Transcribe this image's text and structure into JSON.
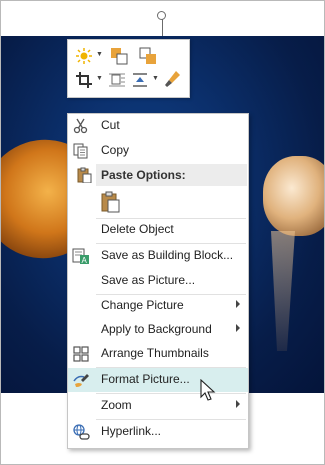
{
  "menu": {
    "cut": "Cut",
    "copy": "Copy",
    "paste_options": "Paste Options:",
    "delete_object": "Delete Object",
    "save_building_block": "Save as Building Block...",
    "save_picture": "Save as Picture...",
    "change_picture": "Change Picture",
    "apply_background": "Apply to Background",
    "arrange_thumbnails": "Arrange Thumbnails",
    "format_picture": "Format Picture...",
    "zoom": "Zoom",
    "hyperlink": "Hyperlink..."
  },
  "icons": {
    "cut": "scissors-icon",
    "copy": "copy-icon",
    "paste": "clipboard-icon",
    "building_block": "building-block-icon",
    "arrange": "thumbnails-grid-icon",
    "format": "format-picture-icon",
    "hyperlink": "hyperlink-icon",
    "cursor": "mouse-pointer-icon"
  },
  "colors": {
    "highlight": "#d8eeee",
    "paste_header_bg": "#ececec",
    "icon_orange": "#e8a33b",
    "icon_blue": "#3a6db4"
  }
}
